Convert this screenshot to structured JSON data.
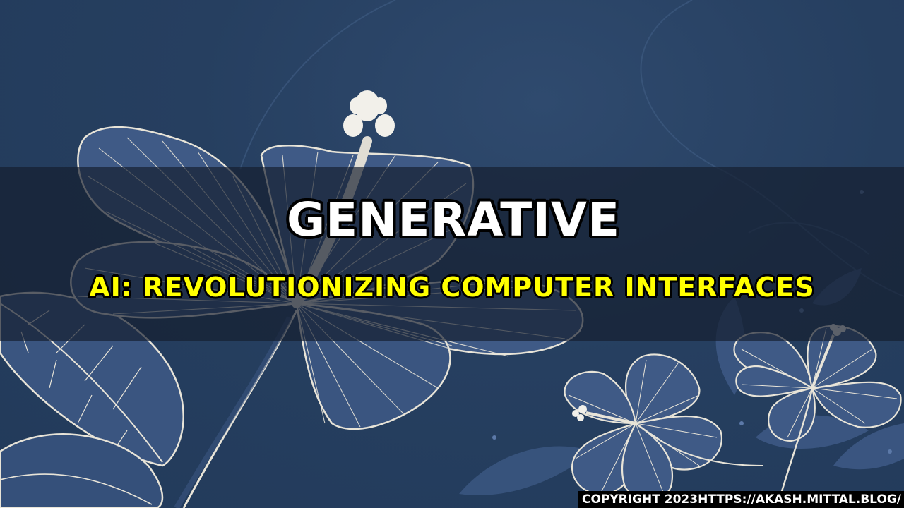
{
  "title": {
    "line1": "GENERATIVE",
    "line2": "AI: REVOLUTIONIZING COMPUTER INTERFACES"
  },
  "copyright": {
    "text": "COPYRIGHT 2023HTTPS://AKASH.MITTAL.BLOG/"
  },
  "colors": {
    "background": "#263f60",
    "band": "#141e2d",
    "title_main": "#ffffff",
    "title_sub": "#ffff00",
    "outline": "#000000",
    "flower_line": "#e8e4d8",
    "flower_fill": "#3f5a86"
  },
  "artwork": {
    "subject": "hibiscus-flower-line-art"
  }
}
